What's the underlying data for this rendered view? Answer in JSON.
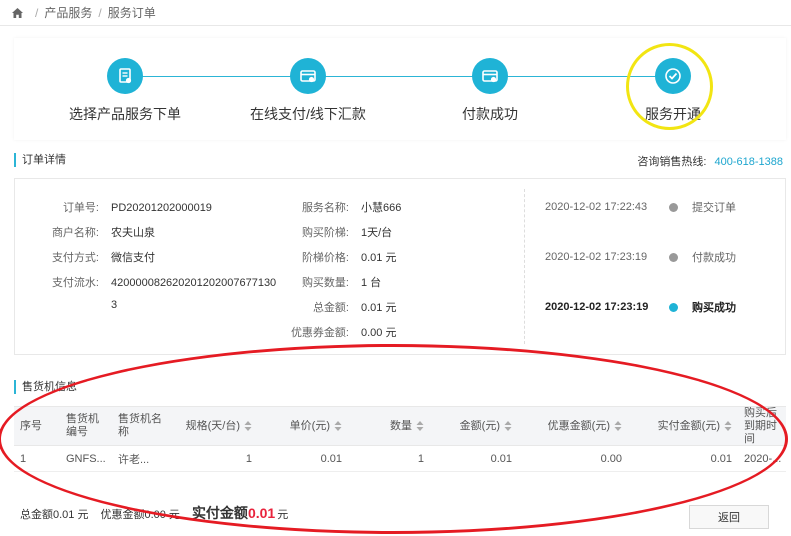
{
  "breadcrumb": {
    "items": [
      "产品服务",
      "服务订单"
    ]
  },
  "steps": [
    {
      "label": "选择产品服务下单",
      "icon": "order-doc-icon"
    },
    {
      "label": "在线支付/线下汇款",
      "icon": "payment-card-icon"
    },
    {
      "label": "付款成功",
      "icon": "payment-success-icon"
    },
    {
      "label": "服务开通",
      "icon": "check-icon"
    }
  ],
  "order_section": {
    "title": "订单详情",
    "hotline_label": "咨询销售热线:",
    "hotline_number": "400-618-1388"
  },
  "order": {
    "left": [
      {
        "k": "订单号:",
        "v": "PD20201202000019"
      },
      {
        "k": "商户名称:",
        "v": "农夫山泉"
      },
      {
        "k": "支付方式:",
        "v": "微信支付"
      },
      {
        "k": "支付流水:",
        "v": "420000082620201202007677130"
      },
      {
        "k": "",
        "v": "3"
      }
    ],
    "right": [
      {
        "k": "服务名称:",
        "v": "小慧666"
      },
      {
        "k": "购买阶梯:",
        "v": "1天/台"
      },
      {
        "k": "阶梯价格:",
        "v": "0.01 元"
      },
      {
        "k": "购买数量:",
        "v": "1 台"
      },
      {
        "k": "总金额:",
        "v": "0.01 元"
      },
      {
        "k": "优惠券金额:",
        "v": "0.00 元"
      }
    ]
  },
  "timeline": [
    {
      "time": "2020-12-02 17:22:43",
      "status": "提交订单"
    },
    {
      "time": "2020-12-02 17:23:19",
      "status": "付款成功"
    },
    {
      "time": "2020-12-02 17:23:19",
      "status": "购买成功"
    }
  ],
  "vending_section": {
    "title": "售货机信息"
  },
  "table": {
    "headers": [
      "序号",
      "售货机编号",
      "售货机名称",
      "规格(天/台)",
      "单价(元)",
      "数量",
      "金额(元)",
      "优惠金额(元)",
      "实付金额(元)",
      "购买后到期时间"
    ],
    "rows": [
      [
        "1",
        "GNFS...",
        "许老...",
        "1",
        "0.01",
        "1",
        "0.01",
        "0.00",
        "0.01",
        "2020-..."
      ]
    ]
  },
  "summary": {
    "total_label": "总金额0.01 元",
    "discount_label": "优惠金额0.00 元",
    "paid_label": "实付金额",
    "paid_amount": "0.01",
    "paid_unit": "元"
  },
  "back_button": "返回",
  "colors": {
    "accent": "#1fb3d6",
    "highlight": "#f2e512",
    "annotation": "#e51b23",
    "amount_red": "#e9233c"
  }
}
